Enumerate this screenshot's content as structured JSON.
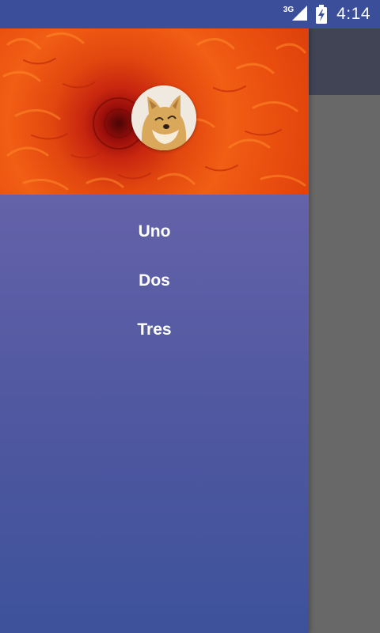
{
  "status_bar": {
    "network_label": "3G",
    "signal_icon": "cell-signal-icon",
    "battery_icon": "battery-charging-icon",
    "time": "4:14"
  },
  "drawer": {
    "header_image": "orange-chrysanthemum",
    "avatar_image": "doge-avatar",
    "menu": [
      {
        "label": "Uno"
      },
      {
        "label": "Dos"
      },
      {
        "label": "Tres"
      }
    ]
  },
  "colors": {
    "status_bar": "#3a4e9a",
    "drawer_top": "#6462a9",
    "drawer_bottom": "#3d529b",
    "scrim": "#686868",
    "toolbar": "#404454"
  }
}
